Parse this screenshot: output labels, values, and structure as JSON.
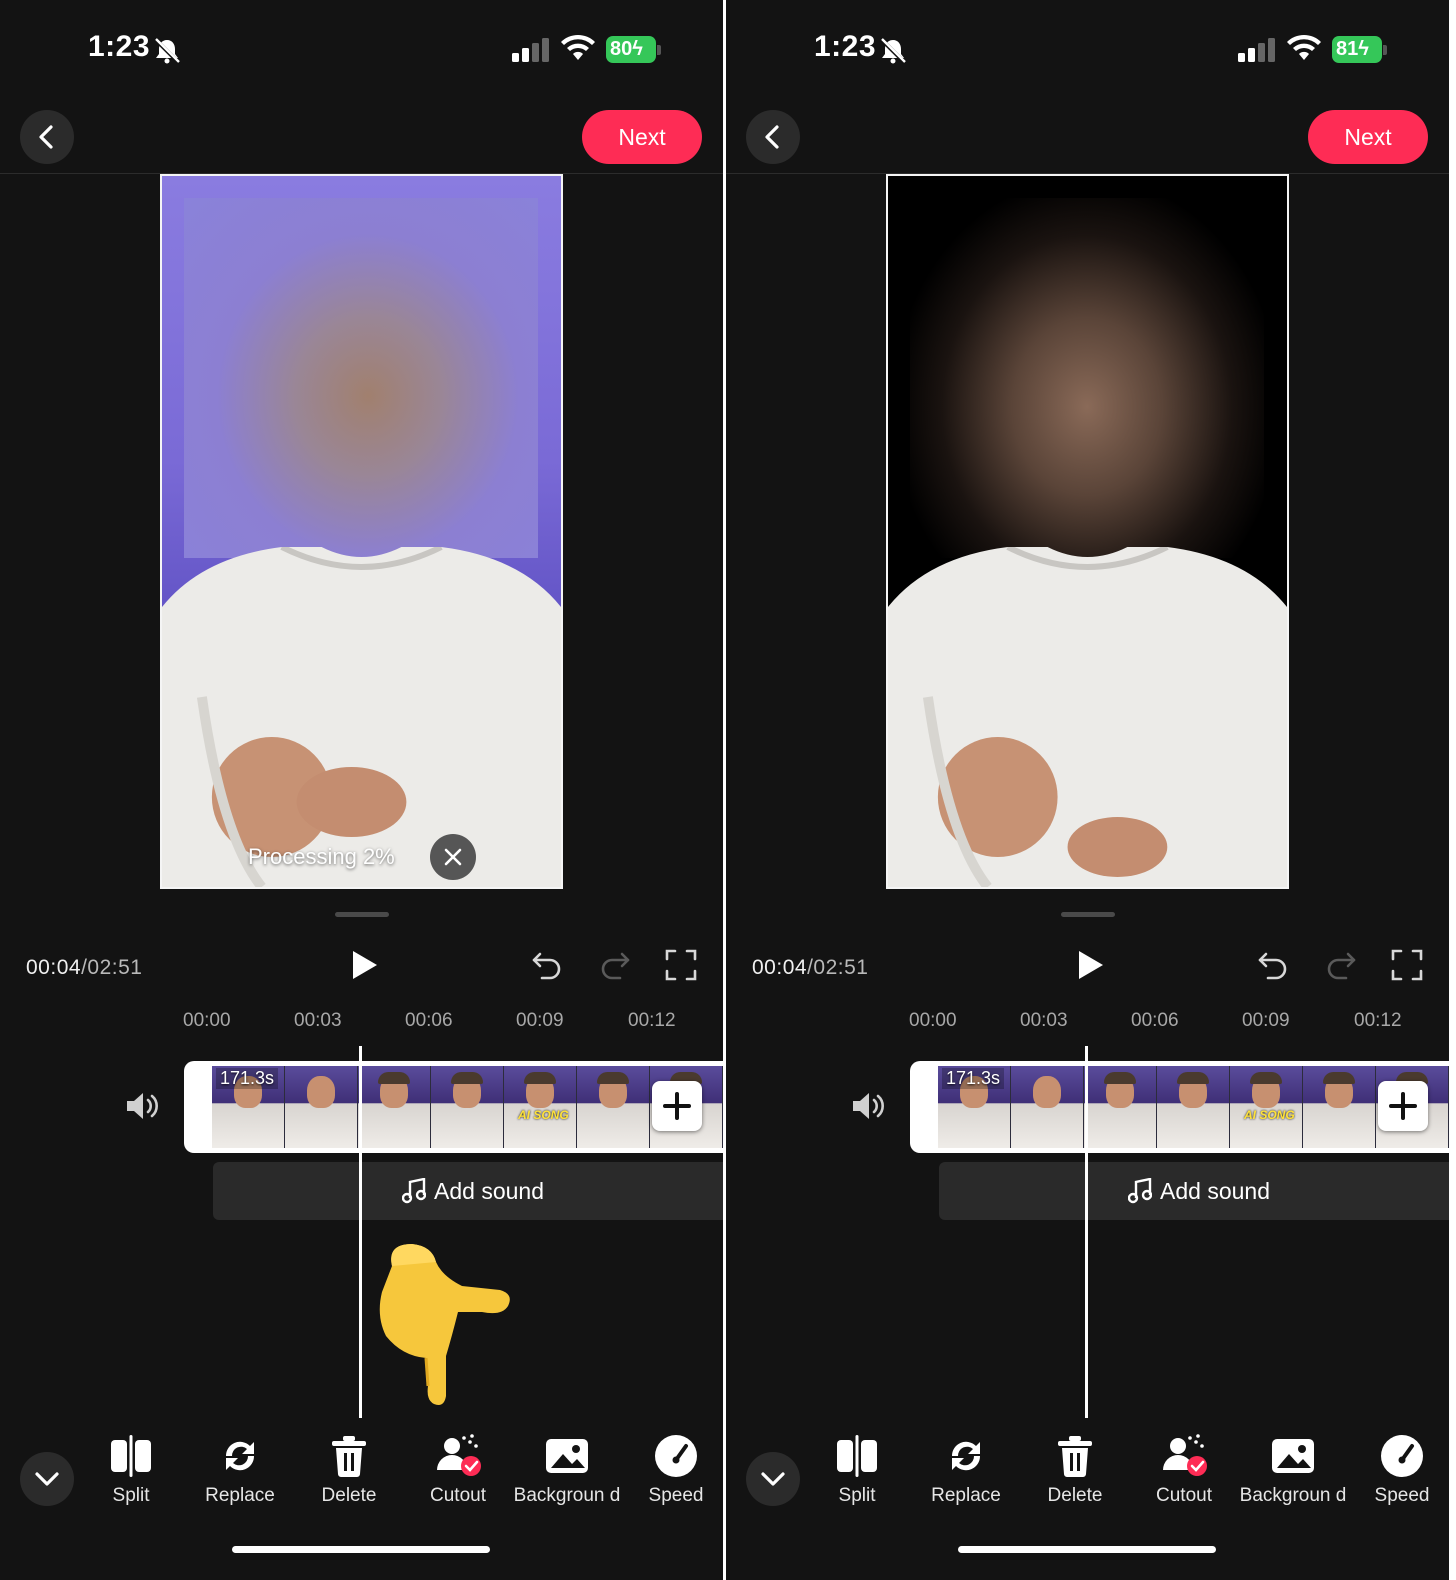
{
  "screens": [
    {
      "id": "left",
      "status": {
        "time": "1:23",
        "battery": "80"
      },
      "next_label": "Next",
      "processing_text": "Processing 2%",
      "timecode": {
        "current": "00:04",
        "total": "/02:51"
      },
      "ruler": [
        "00:00",
        "00:03",
        "00:06",
        "00:09",
        "00:12"
      ],
      "clip": {
        "duration": "171.3s",
        "frame_caption": "AI SONG"
      },
      "add_sound_label": "Add sound",
      "tools": [
        {
          "icon": "split-icon",
          "label": "Split"
        },
        {
          "icon": "replace-icon",
          "label": "Replace"
        },
        {
          "icon": "delete-icon",
          "label": "Delete"
        },
        {
          "icon": "cutout-icon",
          "label": "Cutout"
        },
        {
          "icon": "background-icon",
          "label": "Backgroun d"
        },
        {
          "icon": "speed-icon",
          "label": "Speed"
        }
      ]
    },
    {
      "id": "right",
      "status": {
        "time": "1:23",
        "battery": "81"
      },
      "next_label": "Next",
      "timecode": {
        "current": "00:04",
        "total": "/02:51"
      },
      "ruler": [
        "00:00",
        "00:03",
        "00:06",
        "00:09",
        "00:12"
      ],
      "clip": {
        "duration": "171.3s",
        "frame_caption": "AI SONG"
      },
      "add_sound_label": "Add sound",
      "tools": [
        {
          "icon": "split-icon",
          "label": "Split"
        },
        {
          "icon": "replace-icon",
          "label": "Replace"
        },
        {
          "icon": "delete-icon",
          "label": "Delete"
        },
        {
          "icon": "cutout-icon",
          "label": "Cutout"
        },
        {
          "icon": "background-icon",
          "label": "Backgroun d"
        },
        {
          "icon": "speed-icon",
          "label": "Speed"
        }
      ]
    }
  ],
  "colors": {
    "accent": "#fe2c55",
    "battery": "#35c759",
    "background": "#131313"
  }
}
